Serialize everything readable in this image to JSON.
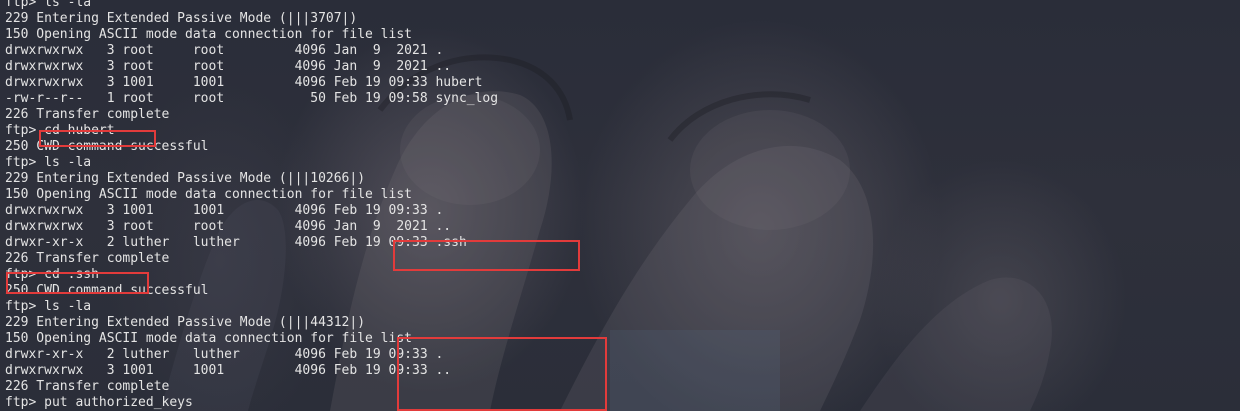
{
  "terminal": {
    "lines": [
      "ftp> ls -la",
      "229 Entering Extended Passive Mode (|||3707|)",
      "150 Opening ASCII mode data connection for file list",
      "drwxrwxrwx   3 root     root         4096 Jan  9  2021 .",
      "drwxrwxrwx   3 root     root         4096 Jan  9  2021 ..",
      "drwxrwxrwx   3 1001     1001         4096 Feb 19 09:33 hubert",
      "-rw-r--r--   1 root     root           50 Feb 19 09:58 sync_log",
      "226 Transfer complete",
      "ftp> cd hubert",
      "250 CWD command successful",
      "ftp> ls -la",
      "229 Entering Extended Passive Mode (|||10266|)",
      "150 Opening ASCII mode data connection for file list",
      "drwxrwxrwx   3 1001     1001         4096 Feb 19 09:33 .",
      "drwxrwxrwx   3 root     root         4096 Jan  9  2021 ..",
      "drwxr-xr-x   2 luther   luther       4096 Feb 19 09:33 .ssh",
      "226 Transfer complete",
      "ftp> cd .ssh",
      "250 CWD command successful",
      "ftp> ls -la",
      "229 Entering Extended Passive Mode (|||44312|)",
      "150 Opening ASCII mode data connection for file list",
      "drwxr-xr-x   2 luther   luther       4096 Feb 19 09:33 .",
      "drwxrwxrwx   3 1001     1001         4096 Feb 19 09:33 ..",
      "226 Transfer complete",
      "ftp> put authorized_keys"
    ]
  },
  "colors": {
    "background": "#2c2f3a",
    "text": "#e4e4e4",
    "highlight_border": "#e23b3b"
  }
}
